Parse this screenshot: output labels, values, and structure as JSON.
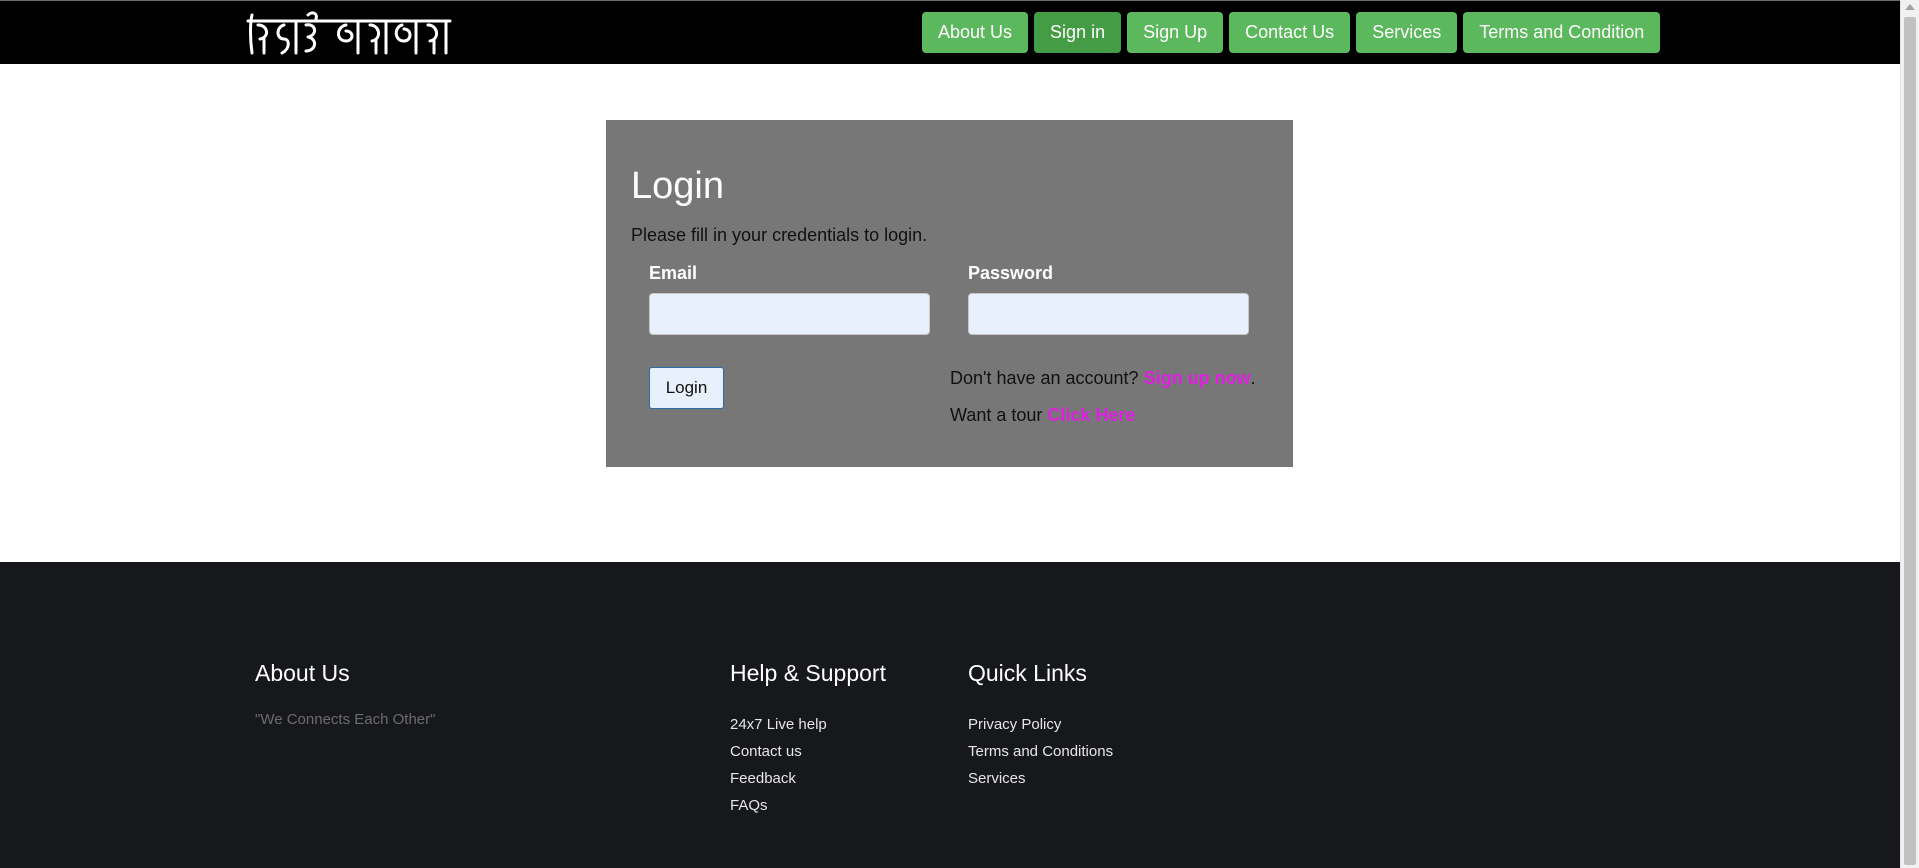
{
  "header": {
    "logo_text": "বিয়ে করবো",
    "nav": [
      {
        "label": "About Us"
      },
      {
        "label": "Sign in"
      },
      {
        "label": "Sign Up"
      },
      {
        "label": "Contact Us"
      },
      {
        "label": "Services"
      },
      {
        "label": "Terms and Condition"
      }
    ]
  },
  "login": {
    "title": "Login",
    "subtitle": "Please fill in your credentials to login.",
    "email_label": "Email",
    "email_value": "",
    "password_label": "Password",
    "password_value": "",
    "submit_label": "Login",
    "signup_prefix": "Don't have an account? ",
    "signup_link": "Sign up now",
    "signup_suffix": ".",
    "tour_prefix": "Want a tour ",
    "tour_link": "Click Here"
  },
  "footer": {
    "about": {
      "heading": "About Us",
      "tagline": "\"We Connects Each Other\""
    },
    "help": {
      "heading": "Help & Support",
      "items": [
        "24x7 Live help",
        "Contact us",
        "Feedback",
        "FAQs"
      ]
    },
    "quick": {
      "heading": "Quick Links",
      "items": [
        "Privacy Policy",
        "Terms and Conditions",
        "Services"
      ]
    }
  },
  "colors": {
    "nav_button": "#5cb85c",
    "nav_button_active": "#449d44",
    "panel": "#777777",
    "link": "#e020e0",
    "footer": "#17181b"
  }
}
